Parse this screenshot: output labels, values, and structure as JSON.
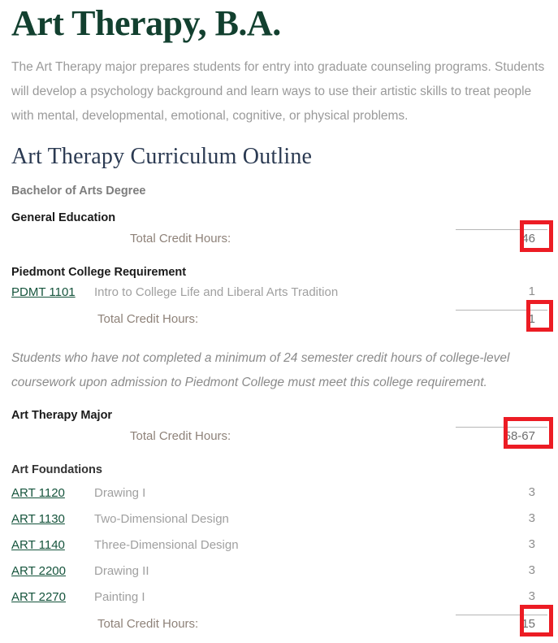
{
  "page": {
    "title": "Art Therapy, B.A.",
    "intro": "The Art Therapy major prepares students for entry into graduate counseling programs. Students will develop a psychology background and learn ways to use their artistic skills to treat people with mental, developmental, emotional, cognitive, or physical problems.",
    "outline_heading": "Art Therapy Curriculum Outline",
    "degree_label": "Bachelor of Arts Degree"
  },
  "labels": {
    "total_credit_hours": "Total Credit Hours:"
  },
  "colors": {
    "title_green": "#12402f",
    "outline_navy": "#2b3a52",
    "link_green": "#15543c",
    "highlight_red": "#ec1c24",
    "body_gray": "#9a9a9a"
  },
  "sections": [
    {
      "heading": "General Education",
      "total": "46",
      "highlighted": true,
      "courses": []
    },
    {
      "heading": "Piedmont College Requirement",
      "total": "1",
      "highlighted": true,
      "courses": [
        {
          "code": "PDMT 1101",
          "title": "Intro to College Life and Liberal Arts Tradition",
          "credits": "1"
        }
      ],
      "note": "Students who have not completed a minimum of 24 semester credit hours of college-level coursework upon admission to Piedmont College must meet this college requirement."
    },
    {
      "heading": "Art Therapy Major",
      "total": "58-67",
      "highlighted": true,
      "courses": []
    },
    {
      "heading": "Art Foundations",
      "total": "15",
      "highlighted": true,
      "courses": [
        {
          "code": "ART 1120",
          "title": "Drawing I",
          "credits": "3"
        },
        {
          "code": "ART 1130",
          "title": "Two-Dimensional Design",
          "credits": "3"
        },
        {
          "code": "ART 1140",
          "title": "Three-Dimensional Design",
          "credits": "3"
        },
        {
          "code": "ART 2200",
          "title": "Drawing II",
          "credits": "3"
        },
        {
          "code": "ART 2270",
          "title": "Painting I",
          "credits": "3"
        }
      ]
    }
  ]
}
